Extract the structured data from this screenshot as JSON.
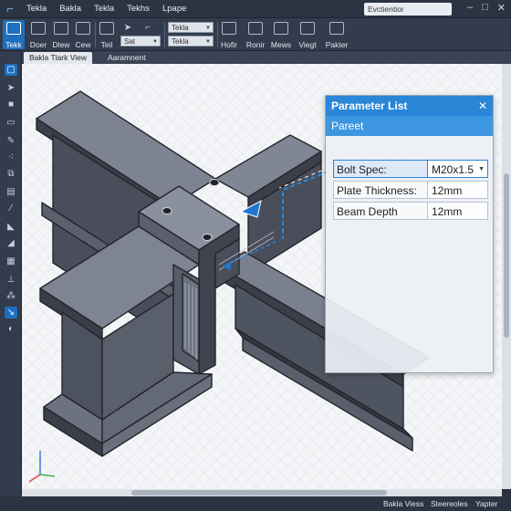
{
  "menubar": {
    "items": [
      "Tekla",
      "Bakla",
      "Tekla",
      "Tekhs",
      "Lpape"
    ],
    "search_text": "Evctientior"
  },
  "ribbon": {
    "buttons": [
      "Tekk",
      "Doer",
      "Dlew",
      "Cew",
      "Teil",
      "Hofir",
      "Ronir",
      "Mews",
      "Viegt",
      "Pakter"
    ],
    "field1": "Sat",
    "field2": "Tekla",
    "field3": "Tekla"
  },
  "view": {
    "tab_active": "Bakla Tlark View",
    "tab_other": "Aaramnent"
  },
  "panel": {
    "title": "Parameter List",
    "subtitle": "Pareet",
    "rows": [
      {
        "label": "Bolt Spec:",
        "value": "M20x1.5"
      },
      {
        "label": "Plate Thickness:",
        "value": "12mm"
      },
      {
        "label": "Beam Depth",
        "value": "12mm"
      }
    ]
  },
  "statusbar": {
    "text1": "Bakla Viess",
    "text2": "Steereoles",
    "text3": "Yapter"
  },
  "colors": {
    "accent": "#2a86d6",
    "chrome": "#333c4c",
    "steel": "#4f5564"
  }
}
